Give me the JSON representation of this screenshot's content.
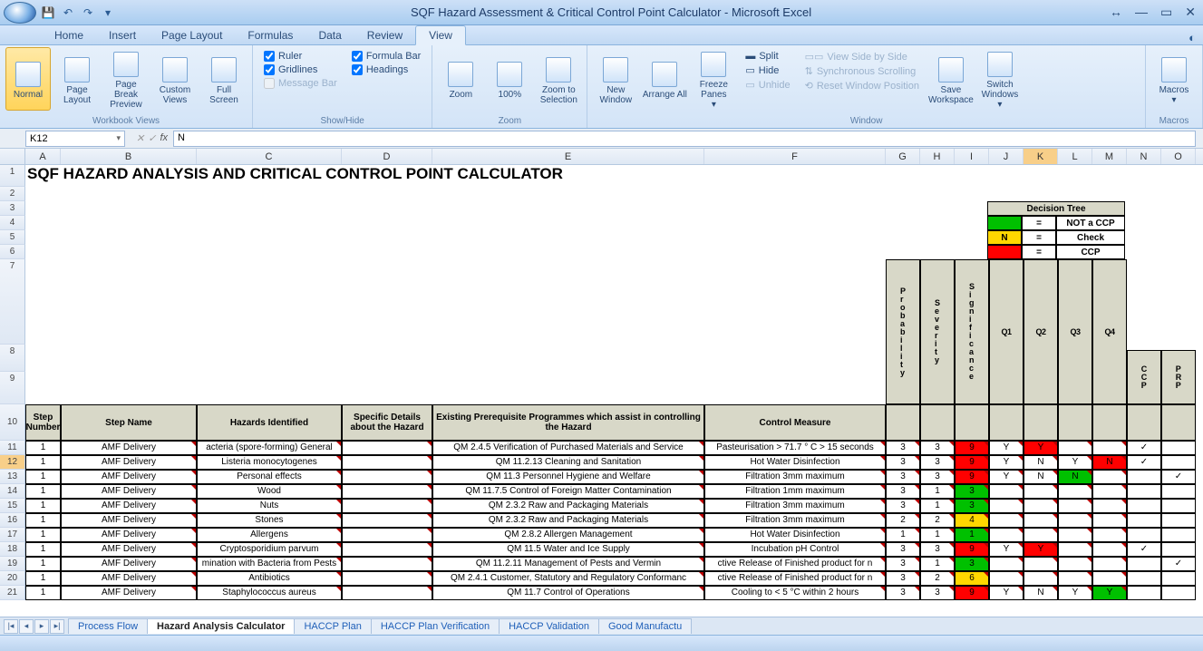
{
  "app": {
    "title": "SQF Hazard Assessment & Critical Control Point Calculator - Microsoft Excel"
  },
  "ribbon": {
    "tabs": [
      "Home",
      "Insert",
      "Page Layout",
      "Formulas",
      "Data",
      "Review",
      "View"
    ],
    "active_tab": "View",
    "groups": {
      "workbook_views": {
        "label": "Workbook Views",
        "buttons": [
          "Normal",
          "Page Layout",
          "Page Break Preview",
          "Custom Views",
          "Full Screen"
        ]
      },
      "show_hide": {
        "label": "Show/Hide",
        "ruler": "Ruler",
        "formula_bar": "Formula Bar",
        "gridlines": "Gridlines",
        "headings": "Headings",
        "message_bar": "Message Bar"
      },
      "zoom": {
        "label": "Zoom",
        "buttons": [
          "Zoom",
          "100%",
          "Zoom to Selection"
        ]
      },
      "window": {
        "label": "Window",
        "buttons": [
          "New Window",
          "Arrange All",
          "Freeze Panes"
        ],
        "split": "Split",
        "hide": "Hide",
        "unhide": "Unhide",
        "side_by_side": "View Side by Side",
        "sync_scroll": "Synchronous Scrolling",
        "reset_pos": "Reset Window Position",
        "save_ws": "Save Workspace",
        "switch_win": "Switch Windows"
      },
      "macros": {
        "label": "Macros",
        "button": "Macros"
      }
    }
  },
  "formula_bar": {
    "name_box": "K12",
    "fx_value": "N"
  },
  "columns": [
    "A",
    "B",
    "C",
    "D",
    "E",
    "F",
    "G",
    "H",
    "I",
    "J",
    "K",
    "L",
    "M",
    "N",
    "O"
  ],
  "title_row": "SQF HAZARD ANALYSIS AND CRITICAL CONTROL POINT CALCULATOR",
  "decision_tree": {
    "header": "Decision Tree",
    "rows": [
      {
        "eq": "=",
        "label": "NOT a CCP",
        "color": "green"
      },
      {
        "code": "N",
        "eq": "=",
        "label": "Check",
        "color": "yellow"
      },
      {
        "eq": "=",
        "label": "CCP",
        "color": "red"
      }
    ]
  },
  "table_headers": {
    "step_number": "Step Number",
    "step_name": "Step Name",
    "hazards": "Hazards Identified",
    "details": "Specific Details about the Hazard",
    "programmes": "Existing Prerequisite Programmes which assist in controlling the Hazard",
    "control": "Control Measure",
    "prob": "Probability",
    "sev": "Severity",
    "sig": "Significance",
    "q1": "Q1",
    "q2": "Q2",
    "q3": "Q3",
    "q4": "Q4",
    "ccp": "CCP",
    "prp": "PRP"
  },
  "rows": [
    {
      "n": 11,
      "step": 1,
      "name": "AMF Delivery",
      "hazard": "acteria (spore-forming) General",
      "details": "",
      "prog": "QM 2.4.5 Verification of Purchased Materials and Service",
      "control": "Pasteurisation > 71.7 ° C > 15 seconds",
      "p": 3,
      "sv": 3,
      "sg": 9,
      "sgc": "red",
      "q1": "Y",
      "q2": "Y",
      "q2c": "red",
      "q3": "",
      "q4": "",
      "ccp": "✓",
      "prp": ""
    },
    {
      "n": 12,
      "step": 1,
      "name": "AMF Delivery",
      "hazard": "Listeria monocytogenes",
      "details": "",
      "prog": "QM 11.2.13 Cleaning and Sanitation",
      "control": "Hot Water Disinfection",
      "p": 3,
      "sv": 3,
      "sg": 9,
      "sgc": "red",
      "q1": "Y",
      "q2": "N",
      "q2sel": true,
      "q3": "Y",
      "q4": "N",
      "q4c": "red",
      "ccp": "✓",
      "prp": ""
    },
    {
      "n": 13,
      "step": 1,
      "name": "AMF Delivery",
      "hazard": "Personal effects",
      "details": "",
      "prog": "QM 11.3 Personnel Hygiene and Welfare",
      "control": "Filtration 3mm maximum",
      "p": 3,
      "sv": 3,
      "sg": 9,
      "sgc": "red",
      "q1": "Y",
      "q2": "N",
      "q3": "N",
      "q3c": "green",
      "q4": "",
      "ccp": "",
      "prp": "✓"
    },
    {
      "n": 14,
      "step": 1,
      "name": "AMF Delivery",
      "hazard": "Wood",
      "details": "",
      "prog": "QM 11.7.5 Control of Foreign Matter Contamination",
      "control": "Filtration 1mm maximum",
      "p": 3,
      "sv": 1,
      "sg": 3,
      "sgc": "green",
      "q1": "",
      "q2": "",
      "q3": "",
      "q4": "",
      "ccp": "",
      "prp": ""
    },
    {
      "n": 15,
      "step": 1,
      "name": "AMF Delivery",
      "hazard": "Nuts",
      "details": "",
      "prog": "QM 2.3.2 Raw and Packaging Materials",
      "control": "Filtration 3mm maximum",
      "p": 3,
      "sv": 1,
      "sg": 3,
      "sgc": "green",
      "q1": "",
      "q2": "",
      "q3": "",
      "q4": "",
      "ccp": "",
      "prp": ""
    },
    {
      "n": 16,
      "step": 1,
      "name": "AMF Delivery",
      "hazard": "Stones",
      "details": "",
      "prog": "QM 2.3.2 Raw and Packaging Materials",
      "control": "Filtration 3mm maximum",
      "p": 2,
      "sv": 2,
      "sg": 4,
      "sgc": "yellow",
      "q1": "",
      "q2": "",
      "q3": "",
      "q4": "",
      "ccp": "",
      "prp": ""
    },
    {
      "n": 17,
      "step": 1,
      "name": "AMF Delivery",
      "hazard": "Allergens",
      "details": "",
      "prog": "QM 2.8.2 Allergen Management",
      "control": "Hot Water Disinfection",
      "p": 1,
      "sv": 1,
      "sg": 1,
      "sgc": "green",
      "q1": "",
      "q2": "",
      "q3": "",
      "q4": "",
      "ccp": "",
      "prp": ""
    },
    {
      "n": 18,
      "step": 1,
      "name": "AMF Delivery",
      "hazard": "Cryptosporidium parvum",
      "details": "",
      "prog": "QM 11.5 Water and Ice Supply",
      "control": "Incubation pH Control",
      "p": 3,
      "sv": 3,
      "sg": 9,
      "sgc": "red",
      "q1": "Y",
      "q2": "Y",
      "q2c": "red",
      "q3": "",
      "q4": "",
      "ccp": "✓",
      "prp": ""
    },
    {
      "n": 19,
      "step": 1,
      "name": "AMF Delivery",
      "hazard": "mination with Bacteria from Pests",
      "details": "",
      "prog": "QM 11.2.11 Management of Pests and Vermin",
      "control": "ctive Release of Finished product for n",
      "p": 3,
      "sv": 1,
      "sg": 3,
      "sgc": "green",
      "q1": "",
      "q2": "",
      "q3": "",
      "q4": "",
      "ccp": "",
      "prp": "✓"
    },
    {
      "n": 20,
      "step": 1,
      "name": "AMF Delivery",
      "hazard": "Antibiotics",
      "details": "",
      "prog": "QM 2.4.1 Customer, Statutory and Regulatory Conformanc",
      "control": "ctive Release of Finished product for n",
      "p": 3,
      "sv": 2,
      "sg": 6,
      "sgc": "yellow",
      "q1": "",
      "q2": "",
      "q3": "",
      "q4": "",
      "ccp": "",
      "prp": ""
    },
    {
      "n": 21,
      "step": 1,
      "name": "AMF Delivery",
      "hazard": "Staphylococcus aureus",
      "details": "",
      "prog": "QM 11.7 Control of Operations",
      "control": "Cooling to < 5 °C within 2 hours",
      "p": 3,
      "sv": 3,
      "sg": 9,
      "sgc": "red",
      "q1": "Y",
      "q2": "N",
      "q3": "Y",
      "q4": "Y",
      "q4c": "green",
      "ccp": "",
      "prp": ""
    }
  ],
  "sheet_tabs": [
    "Process Flow",
    "Hazard Analysis Calculator",
    "HACCP Plan",
    "HACCP Plan Verification",
    "HACCP Validation",
    "Good Manufactu"
  ],
  "active_sheet": "Hazard Analysis Calculator",
  "selected_cell": "K12",
  "selected_row": 12,
  "selected_col": "K"
}
